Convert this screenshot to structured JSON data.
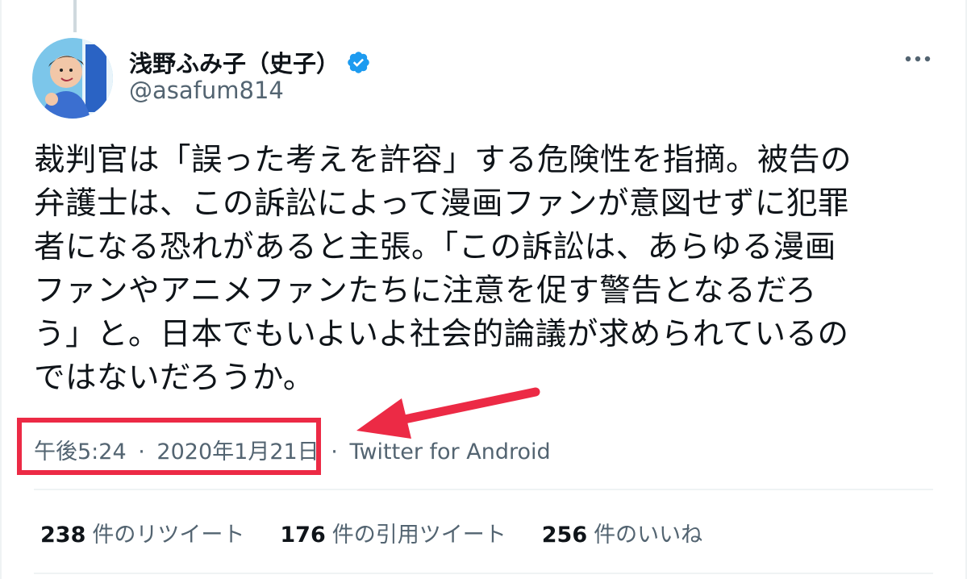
{
  "author": {
    "display_name": "浅野ふみ子（史子）",
    "handle": "@asafum814",
    "verified": true
  },
  "tweet": {
    "text_lines": [
      "裁判官は「誤った考えを許容」する危険性を指摘。被告の",
      "弁護士は、この訴訟によって漫画ファンが意図せずに犯罪",
      "者になる恐れがあると主張。「この訴訟は、あらゆる漫画",
      "ファンやアニメファンたちに注意を促す警告となるだろ",
      "う」と。日本でもいよいよ社会的論議が求められているの",
      "ではないだろうか。"
    ],
    "time": "午後5:24",
    "date": "2020年1月21日",
    "source": "Twitter for Android",
    "separator": "·"
  },
  "stats": {
    "retweets": {
      "count": "238",
      "label": "件のリツイート"
    },
    "quotes": {
      "count": "176",
      "label": "件の引用ツイート"
    },
    "likes": {
      "count": "256",
      "label": "件のいいね"
    }
  },
  "icons": {
    "verified": "verified-badge-icon",
    "more": "more-options-icon",
    "annotation_arrow": "red-arrow-icon"
  },
  "colors": {
    "verified_blue": "#1d9bf0",
    "annotation_red": "#ec2a45",
    "secondary_text": "#536471",
    "primary_text": "#0f1419"
  }
}
